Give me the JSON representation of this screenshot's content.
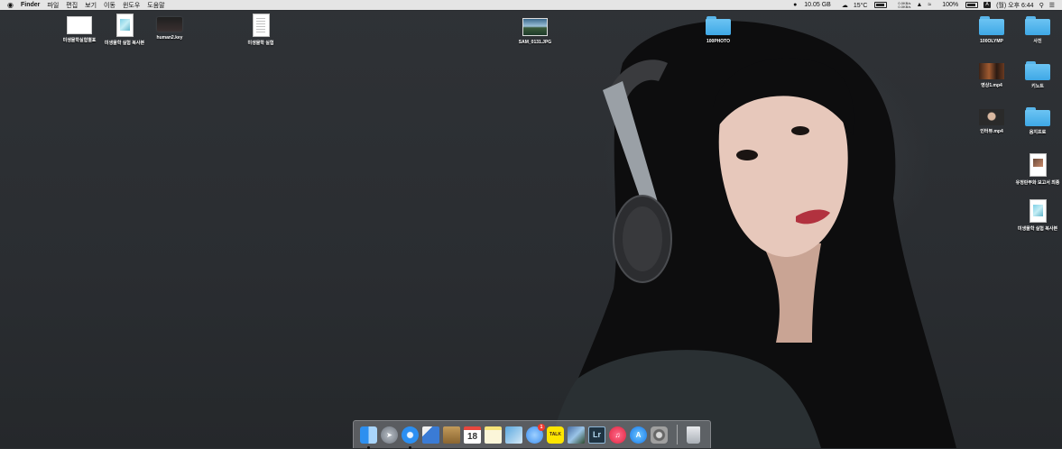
{
  "menubar": {
    "apple": "",
    "app_name": "Finder",
    "menus": [
      "파일",
      "편집",
      "보기",
      "이동",
      "윈도우",
      "도움말"
    ],
    "status": {
      "disk": "10.05 GB",
      "weather": "15°C",
      "net_up": "0.0KB/s",
      "net_down": "0.0KB/s",
      "battery": "100%",
      "ime": "A",
      "clock": "(월) 오후 6:44"
    }
  },
  "desktop_icons": [
    {
      "name": "미생물학실험별표",
      "kind": "doc-white"
    },
    {
      "name": "미생물학 실험 복사본",
      "kind": "doc-pic"
    },
    {
      "name": "human2.key",
      "kind": "keynote"
    },
    {
      "name": "미생물학 실험",
      "kind": "doc-lines"
    },
    {
      "name": "SAM_0131.JPG",
      "kind": "photo"
    },
    {
      "name": "100PHOTO",
      "kind": "folder"
    },
    {
      "name": "100OLYMP",
      "kind": "folder"
    },
    {
      "name": "사진",
      "kind": "folder"
    },
    {
      "name": "영상1.mp4",
      "kind": "video1"
    },
    {
      "name": "키노트",
      "kind": "folder"
    },
    {
      "name": "인터뷰.mp4",
      "kind": "video2"
    },
    {
      "name": "음지프로",
      "kind": "folder"
    },
    {
      "name": "유정란부화 보고서 최종",
      "kind": "doc-dark"
    },
    {
      "name": "미생물학 실험 복사본",
      "kind": "doc-pic"
    }
  ],
  "dock": {
    "calendar_day": "18",
    "messages_badge": "1",
    "kakao_label": "TALK",
    "lightroom_label": "Lr",
    "items": [
      {
        "name": "finder-icon"
      },
      {
        "name": "launchpad-icon"
      },
      {
        "name": "safari-icon"
      },
      {
        "name": "preview-icon"
      },
      {
        "name": "contacts-icon"
      },
      {
        "name": "calendar-icon"
      },
      {
        "name": "notes-icon"
      },
      {
        "name": "preview-doc-icon"
      },
      {
        "name": "messages-icon"
      },
      {
        "name": "kakaotalk-icon"
      },
      {
        "name": "photos-icon"
      },
      {
        "name": "lightroom-icon"
      },
      {
        "name": "itunes-icon"
      },
      {
        "name": "app-store-icon"
      },
      {
        "name": "system-preferences-icon"
      },
      {
        "name": "trash-icon"
      }
    ]
  }
}
